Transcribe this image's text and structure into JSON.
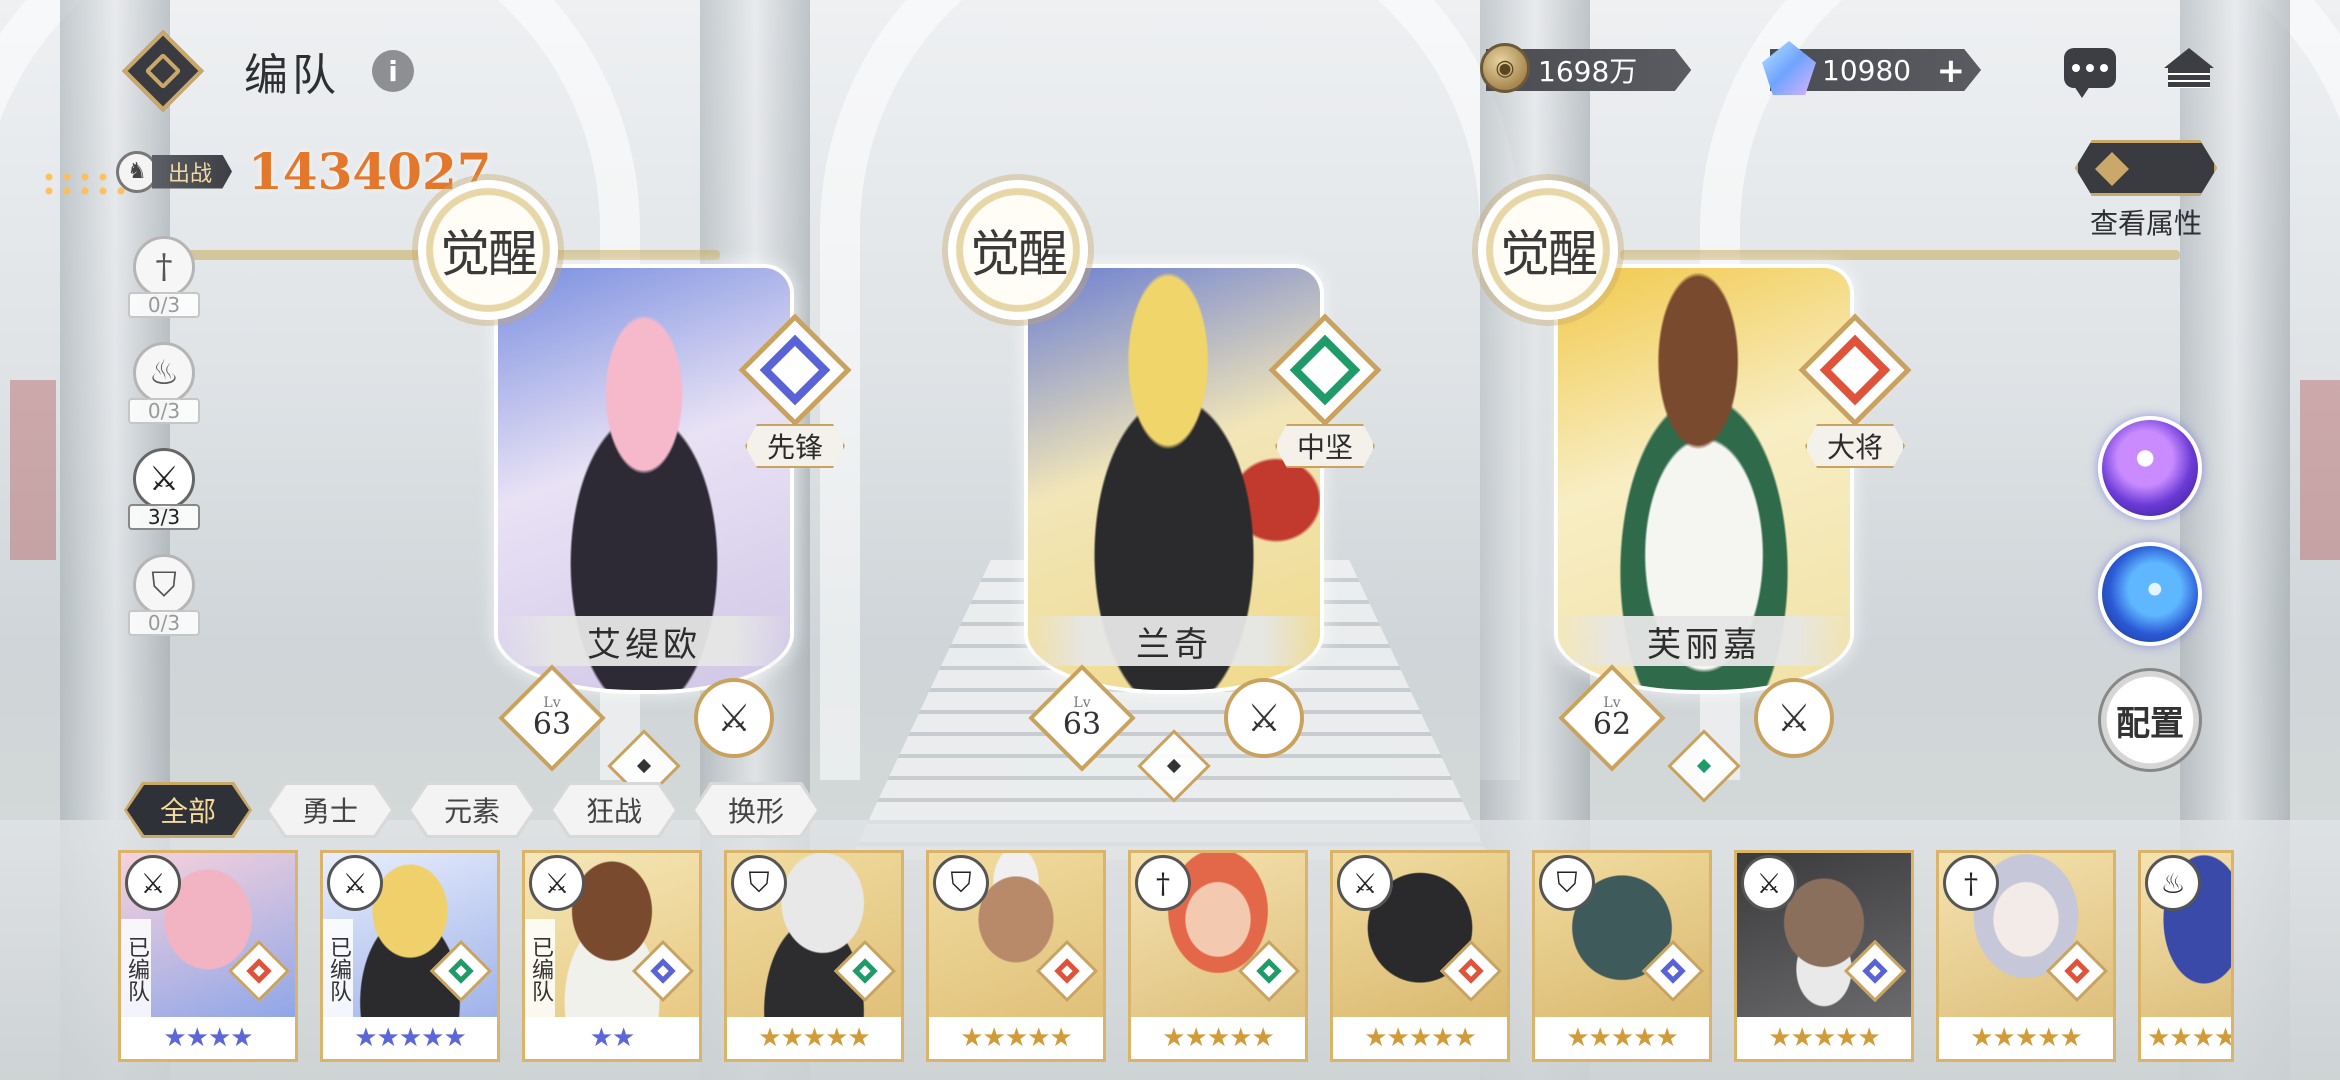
{
  "header": {
    "title": "编队",
    "power_label": "出战",
    "power_value": "1434027"
  },
  "currency": {
    "gold": "1698万",
    "gems": "10980"
  },
  "view_attributes_label": "查看属性",
  "class_filters": [
    {
      "icon": "sword-icon",
      "count": "0/3",
      "active": false
    },
    {
      "icon": "flame-icon",
      "count": "0/3",
      "active": false
    },
    {
      "icon": "axe-icon",
      "count": "3/3",
      "active": true
    },
    {
      "icon": "shield-icon",
      "count": "0/3",
      "active": false
    }
  ],
  "team": [
    {
      "badge": "觉醒",
      "name": "艾缇欧",
      "role": "先锋",
      "level_prefix": "Lv",
      "level": "63",
      "class_icon": "axe-icon",
      "role_color": "#5a63d6"
    },
    {
      "badge": "觉醒",
      "name": "兰奇",
      "role": "中坚",
      "level_prefix": "Lv",
      "level": "63",
      "class_icon": "axe-icon",
      "role_color": "#1f9b6a"
    },
    {
      "badge": "觉醒",
      "name": "芙丽嘉",
      "role": "大将",
      "level_prefix": "Lv",
      "level": "62",
      "class_icon": "axe-icon",
      "role_color": "#e0533b"
    }
  ],
  "config_label": "配置",
  "tabs": [
    "全部",
    "勇士",
    "元素",
    "狂战",
    "换形"
  ],
  "roster": [
    {
      "class_icon": "axe-icon",
      "assigned": "已编队",
      "stars": "★★★★",
      "star_color": "blue",
      "role_color": "#e0533b",
      "bg": "#f2b4c3"
    },
    {
      "class_icon": "axe-icon",
      "assigned": "已编队",
      "stars": "★★★★★",
      "star_color": "blue",
      "role_color": "#1f9b6a",
      "bg": "#d9c98b"
    },
    {
      "class_icon": "axe-icon",
      "assigned": "已编队",
      "stars": "★★",
      "star_color": "blue",
      "role_color": "#5a63d6",
      "bg": "#c8a98e"
    },
    {
      "class_icon": "shield-icon",
      "assigned": "",
      "stars": "★★★★★",
      "star_color": "gold",
      "role_color": "#1f9b6a",
      "bg": "#c7c7c7"
    },
    {
      "class_icon": "shield-icon",
      "assigned": "",
      "stars": "★★★★★",
      "star_color": "gold",
      "role_color": "#e0533b",
      "bg": "#b88a6a"
    },
    {
      "class_icon": "sword-icon",
      "assigned": "",
      "stars": "★★★★★",
      "star_color": "gold",
      "role_color": "#1f9b6a",
      "bg": "#e59a7d"
    },
    {
      "class_icon": "axe-icon",
      "assigned": "",
      "stars": "★★★★★",
      "star_color": "gold",
      "role_color": "#e0533b",
      "bg": "#4a4a4f"
    },
    {
      "class_icon": "shield-icon",
      "assigned": "",
      "stars": "★★★★★",
      "star_color": "gold",
      "role_color": "#5a63d6",
      "bg": "#3f5a5a"
    },
    {
      "class_icon": "axe-icon",
      "assigned": "",
      "stars": "★★★★★",
      "star_color": "gold",
      "role_color": "#5a63d6",
      "bg": "#8a6f5c"
    },
    {
      "class_icon": "sword-icon",
      "assigned": "",
      "stars": "★★★★★",
      "star_color": "gold",
      "role_color": "#e0533b",
      "bg": "#c6c7d8"
    },
    {
      "class_icon": "flame-icon",
      "assigned": "",
      "stars": "★★★★★",
      "star_color": "gold",
      "role_color": "#5a63d6",
      "bg": "#3a4aa8"
    }
  ]
}
